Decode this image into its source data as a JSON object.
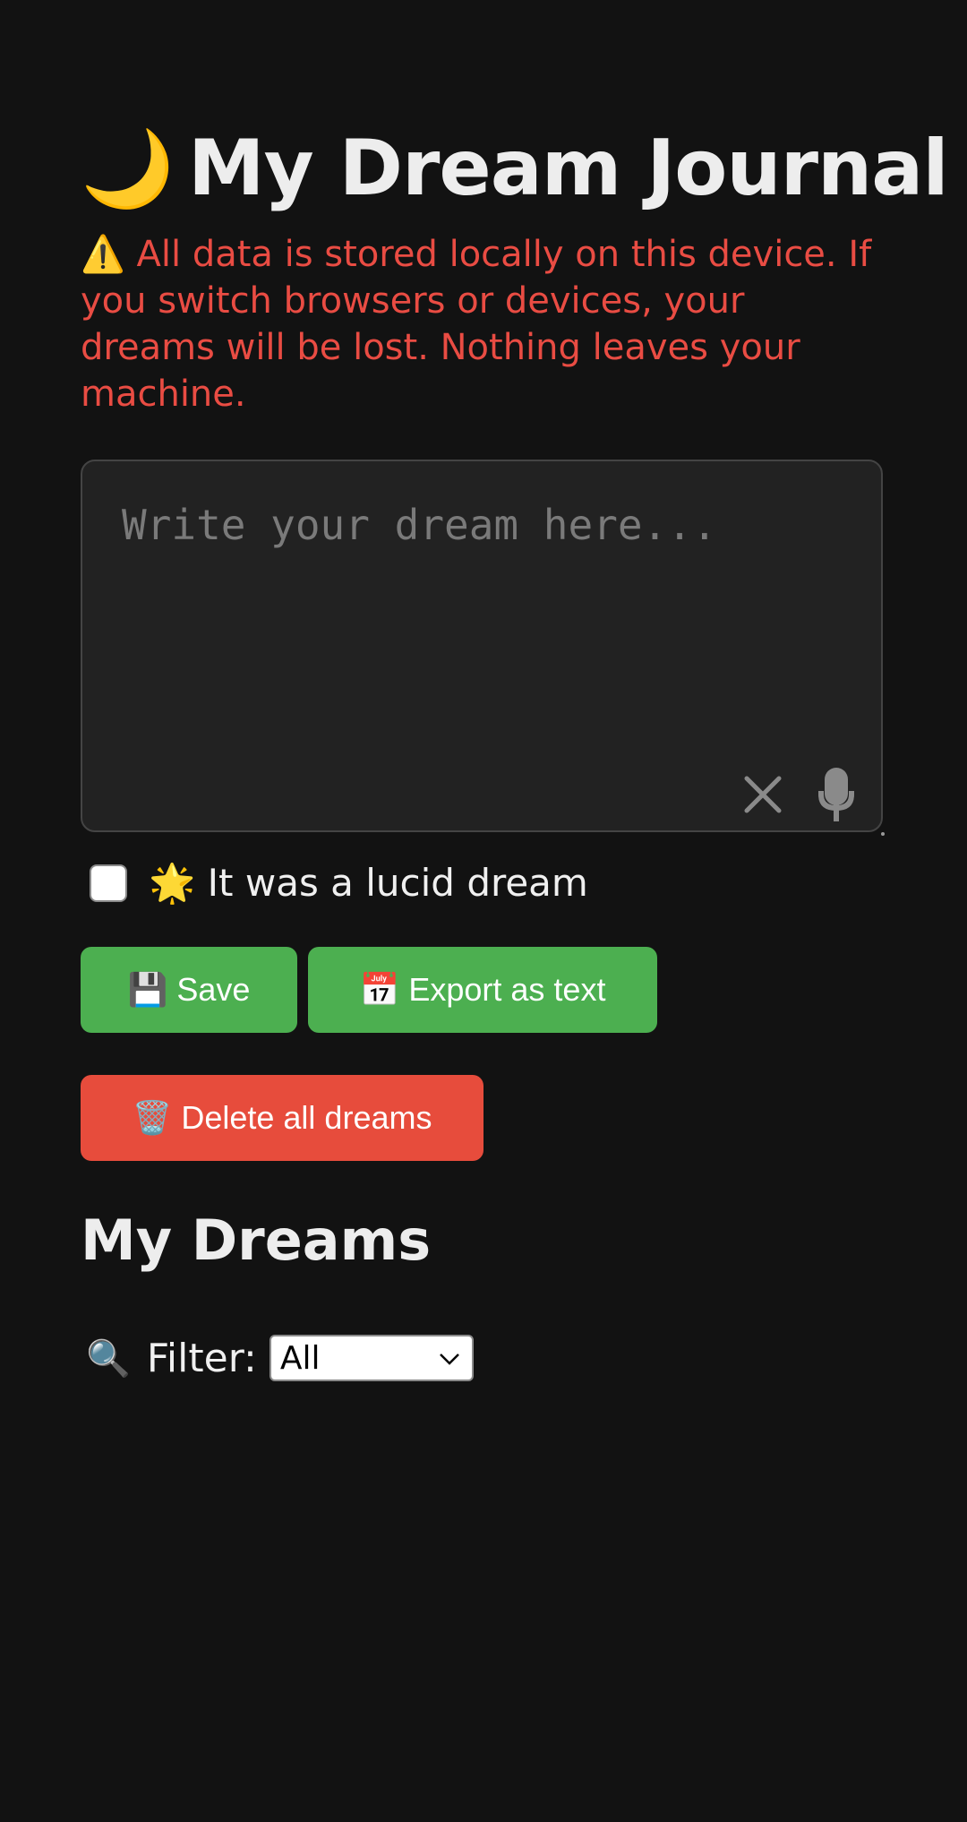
{
  "header": {
    "moon_icon": "🌙",
    "title": "My Dream Journal"
  },
  "warning": {
    "text": "⚠️ All data is stored locally on this device. If you switch browsers or devices, your dreams will be lost. Nothing leaves your machine.",
    "color": "#e94c43"
  },
  "editor": {
    "placeholder": "Write your dream here...",
    "value": "",
    "clear_icon": "close-icon",
    "mic_icon": "microphone-icon"
  },
  "lucid": {
    "checked": false,
    "label": "🌟 It was a lucid dream"
  },
  "actions": {
    "save_emoji": "💾",
    "save_label": "Save",
    "export_emoji": "📅",
    "export_label": "Export as text",
    "delete_emoji": "🗑️",
    "delete_label": "Delete all dreams",
    "primary_color": "#4caf50",
    "danger_color": "#e74c3c"
  },
  "dreams": {
    "section_title": "My Dreams",
    "filter_icon": "🔍",
    "filter_label": "Filter:",
    "filter_selected": "All"
  }
}
